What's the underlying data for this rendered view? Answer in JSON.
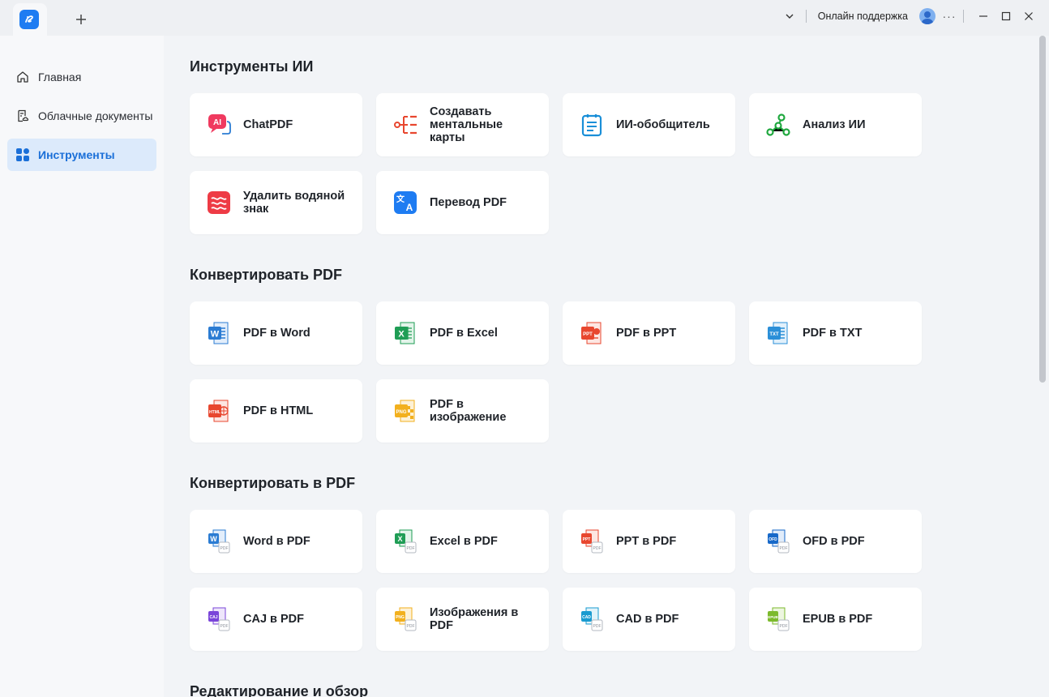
{
  "window": {
    "support_label": "Онлайн поддержка",
    "more_label": "···"
  },
  "sidebar": {
    "items": [
      {
        "label": "Главная",
        "icon": "home-icon"
      },
      {
        "label": "Облачные документы",
        "icon": "cloud-docs-icon"
      },
      {
        "label": "Инструменты",
        "icon": "tools-grid-icon",
        "active": true
      }
    ]
  },
  "sections": [
    {
      "title": "Инструменты ИИ",
      "cards": [
        {
          "label": "ChatPDF",
          "icon": "chatpdf-ai-icon"
        },
        {
          "label": "Создавать ментальные карты",
          "icon": "mind-map-icon"
        },
        {
          "label": "ИИ-обобщитель",
          "icon": "ai-summarizer-icon"
        },
        {
          "label": "Анализ ИИ",
          "icon": "ai-analysis-icon"
        },
        {
          "label": "Удалить водяной знак",
          "icon": "remove-watermark-icon"
        },
        {
          "label": "Перевод PDF",
          "icon": "translate-icon"
        }
      ]
    },
    {
      "title": "Конвертировать PDF",
      "cards": [
        {
          "label": "PDF в Word",
          "icon": "word-file-icon"
        },
        {
          "label": "PDF в Excel",
          "icon": "excel-file-icon"
        },
        {
          "label": "PDF в PPT",
          "icon": "ppt-file-icon"
        },
        {
          "label": "PDF в TXT",
          "icon": "txt-file-icon"
        },
        {
          "label": "PDF в HTML",
          "icon": "html-file-icon"
        },
        {
          "label": "PDF в изображение",
          "icon": "png-file-icon"
        }
      ]
    },
    {
      "title": "Конвертировать в PDF",
      "cards": [
        {
          "label": "Word в PDF",
          "icon": "word-to-pdf-icon"
        },
        {
          "label": "Excel в PDF",
          "icon": "excel-to-pdf-icon"
        },
        {
          "label": "PPT в PDF",
          "icon": "ppt-to-pdf-icon"
        },
        {
          "label": "OFD в PDF",
          "icon": "ofd-to-pdf-icon"
        },
        {
          "label": "CAJ в PDF",
          "icon": "caj-to-pdf-icon"
        },
        {
          "label": "Изображения в PDF",
          "icon": "image-to-pdf-icon"
        },
        {
          "label": "CAD в PDF",
          "icon": "cad-to-pdf-icon"
        },
        {
          "label": "EPUB в PDF",
          "icon": "epub-to-pdf-icon"
        }
      ]
    },
    {
      "title": "Редактирование и обзор",
      "cards": []
    }
  ],
  "colors": {
    "accent": "#1a6fd8",
    "word": "#2b7cd3",
    "excel": "#1f9d55",
    "ppt": "#e8472f",
    "txt": "#2b8fd8",
    "html": "#e8472f",
    "png": "#f2b01e",
    "ofd": "#1769c9",
    "caj": "#7a45d9",
    "cad": "#1a9bd0",
    "epub": "#7cba2c"
  }
}
